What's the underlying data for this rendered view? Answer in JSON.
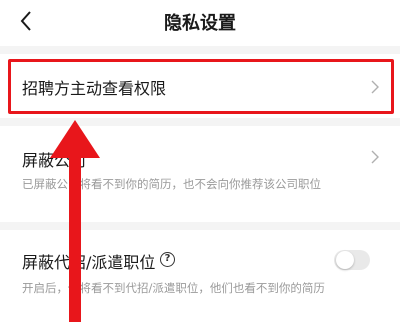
{
  "header": {
    "title": "隐私设置",
    "back_icon": "chevron-left-icon"
  },
  "settings": {
    "recruiter_view": {
      "label": "招聘方主动查看权限",
      "highlighted": true,
      "highlight_color": "#e8161b"
    },
    "block_companies": {
      "label": "屏蔽公司",
      "description": "已屏蔽公司将看不到你的简历，也不会向你推荐该公司职位"
    },
    "block_agency_jobs": {
      "label": "屏蔽代招/派遣职位",
      "help_icon": "question-circle-icon",
      "toggle_on": false,
      "description": "开启后，你将看不到代招/派遣职位，他们也看不到你的简历"
    }
  },
  "annotation": {
    "arrow_color": "#e8161b",
    "arrow_direction": "up"
  }
}
